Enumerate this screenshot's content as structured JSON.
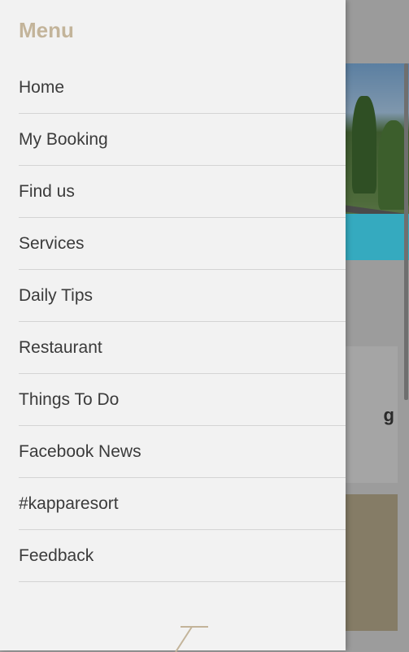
{
  "drawer": {
    "title": "Menu",
    "items": [
      {
        "label": "Home"
      },
      {
        "label": "My Booking"
      },
      {
        "label": "Find us"
      },
      {
        "label": "Services"
      },
      {
        "label": "Daily Tips"
      },
      {
        "label": "Restaurant"
      },
      {
        "label": "Things To Do"
      },
      {
        "label": "Facebook News"
      },
      {
        "label": "#kapparesort"
      },
      {
        "label": "Feedback"
      }
    ]
  },
  "background": {
    "card_text_fragment": "g"
  },
  "colors": {
    "drawer_bg": "#f2f2f2",
    "title_accent": "#c3b49a",
    "item_text": "#3b3b3b",
    "divider": "#d4d4d4",
    "scrim": "#9c9c9c"
  }
}
